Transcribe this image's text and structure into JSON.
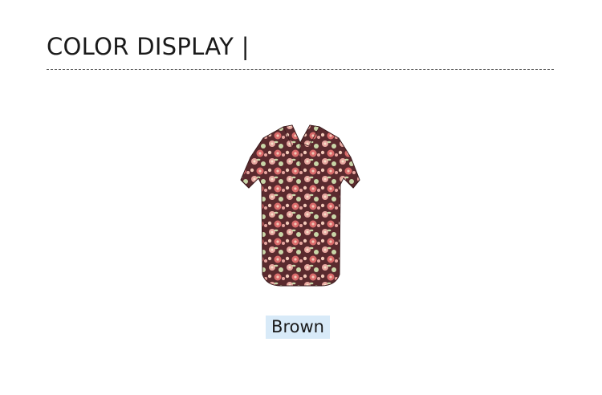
{
  "section": {
    "title": "COLOR DISPLAY |"
  },
  "product": {
    "color_label": "Brown",
    "image_description_icon": "floral-blouse-image"
  },
  "colors": {
    "label_background": "#d8eaf8",
    "print_base": "#5a2a2e",
    "print_accents": [
      "#e8a7a0",
      "#f2c9b8",
      "#c9d6a8",
      "#d96a6a",
      "#f5e0c8"
    ]
  }
}
